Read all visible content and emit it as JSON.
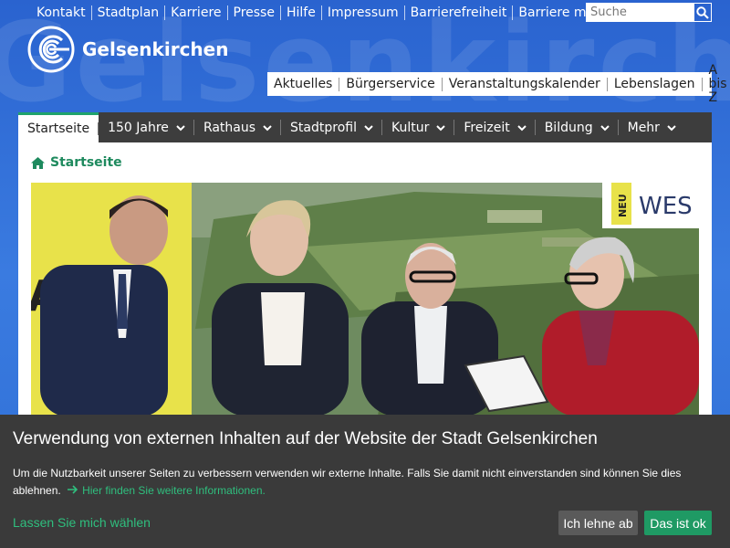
{
  "background": {
    "watermark": "Gelsenkirchen"
  },
  "top_links": [
    "Kontakt",
    "Stadtplan",
    "Karriere",
    "Presse",
    "Hilfe",
    "Impressum",
    "Barrierefreiheit",
    "Barriere melden"
  ],
  "search": {
    "placeholder": "Suche",
    "icon": "search-icon"
  },
  "logo": {
    "text": "Gelsenkirchen"
  },
  "secondary_nav": [
    "Aktuelles",
    "Bürgerservice",
    "Veranstaltungskalender",
    "Lebenslagen",
    "A bis Z"
  ],
  "main_nav": [
    {
      "label": "Startseite",
      "active": true
    },
    {
      "label": "150 Jahre",
      "dropdown": true
    },
    {
      "label": "Rathaus",
      "dropdown": true
    },
    {
      "label": "Stadtprofil",
      "dropdown": true
    },
    {
      "label": "Kultur",
      "dropdown": true
    },
    {
      "label": "Freizeit",
      "dropdown": true
    },
    {
      "label": "Bildung",
      "dropdown": true
    },
    {
      "label": "Mehr",
      "dropdown": true
    }
  ],
  "breadcrumb": {
    "label": "Startseite",
    "icon": "home-icon"
  },
  "hero": {
    "banner_lines": [
      "NEU",
      "WES"
    ]
  },
  "cookie": {
    "title": "Verwendung von externen Inhalten auf der Website der Stadt Gelsenkirchen",
    "text": "Um die Nutzbarkeit unserer Seiten zu verbessern verwenden wir externe Inhalte. Falls Sie damit nicht einverstanden sind können Sie dies ablehnen.",
    "more_link": "Hier finden Sie weitere Informationen.",
    "choose_link": "Lassen Sie mich wählen",
    "reject_label": "Ich lehne ab",
    "accept_label": "Das ist ok"
  },
  "colors": {
    "accent_green": "#1f9a64",
    "link_green": "#2fbf7e",
    "nav_dark": "#3d3d3d",
    "brand_blue": "#2f6fd6"
  }
}
